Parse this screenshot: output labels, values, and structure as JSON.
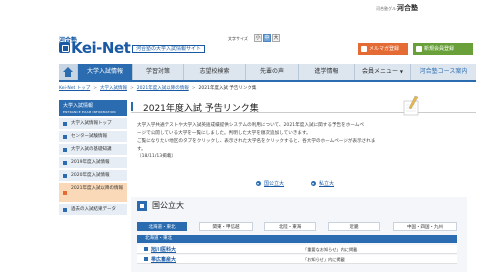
{
  "header": {
    "group_label": "河合塾グループ",
    "group_logo": "河合塾",
    "brand_small": "河合塾",
    "brand_big": "Kei-Net",
    "tagline": "河合塾の大学入試情報サイト",
    "size_label": "文字サイズ",
    "size_buttons": [
      "小",
      "中",
      "大"
    ],
    "mail_button": "メルマガ登録",
    "info_button": "新規会員登録"
  },
  "nav": {
    "items": [
      "大学入試情報",
      "学習対策",
      "志望校検索",
      "先輩の声",
      "進学情報",
      "会員メニュー",
      "河合塾コース案内"
    ]
  },
  "breadcrumb": {
    "items": [
      "Kei-Net トップ",
      "大学入試情報",
      "2021年度入試以降の情報",
      "2021年度入試 予告リンク集"
    ]
  },
  "sidebar": {
    "title": "大学入試情報",
    "subtitle": "ENTRANCE EXAM INFORMATION",
    "items": [
      "大学入試情報トップ",
      "センター試験情報",
      "大学入試の基礎知識",
      "2019年度入試情報",
      "2020年度入試情報",
      "2021年度入試以降の情報",
      "過去の入試結果データ"
    ]
  },
  "main": {
    "title": "2021年度入試 予告リンク集",
    "description_lines": [
      "大学入学共通テストや大学入試英語成績提供システムの利用について、2021年度入試に関する予告をホームペ",
      "ージで公開している大学を一覧にしました。判明した大学を順次追加していきます。",
      "ご覧になりたい地区のタブをクリックし、表示された大学名をクリックすると、各大学のホームページが表示されま",
      "す。"
    ],
    "date": "（18/11/13掲載）",
    "anchors": [
      "国公立大",
      "私立大"
    ],
    "section_title": "国公立大",
    "tabs": [
      "北海道・東北",
      "関東・甲信越",
      "北陸・東海",
      "近畿",
      "中国・四国・九州"
    ],
    "region": "北海道・東北",
    "rows": [
      {
        "name": "旭川医科大",
        "note": "「重要なお知らせ」内に掲載"
      },
      {
        "name": "帯広畜産大",
        "note": "「お知らせ」内に掲載"
      }
    ]
  },
  "colors": {
    "primary_blue": "#2b6cb0",
    "link_blue": "#1a5aa5",
    "mail_orange": "#e46b33",
    "register_green": "#6aa03a"
  }
}
